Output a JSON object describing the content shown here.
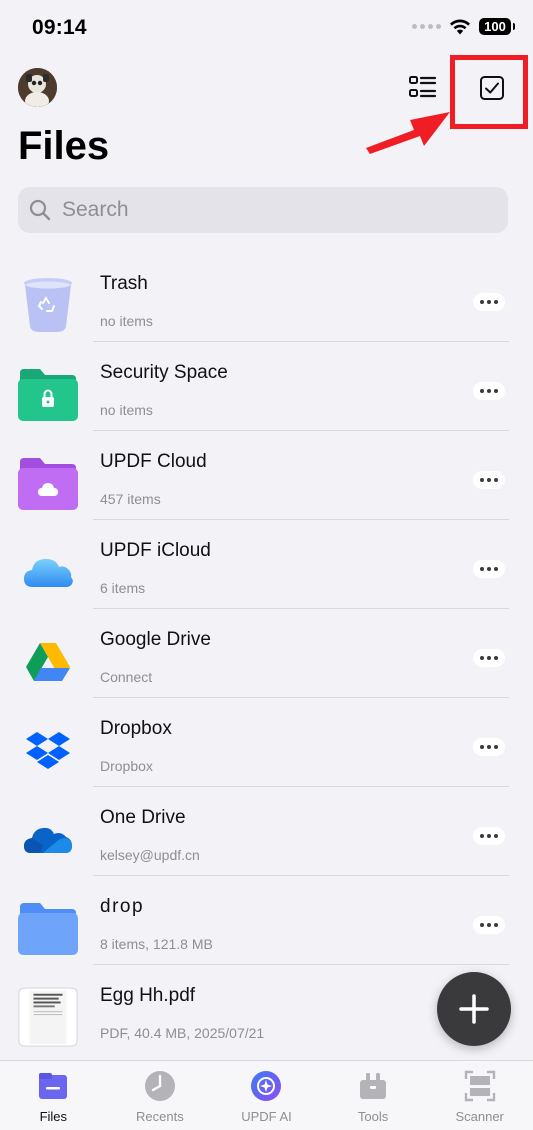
{
  "status_bar": {
    "time": "09:14",
    "battery": "100"
  },
  "header": {
    "title": "Files"
  },
  "search": {
    "placeholder": "Search"
  },
  "files": [
    {
      "name": "Trash",
      "subtitle": "no items",
      "icon": "trash-icon"
    },
    {
      "name": "Security Space",
      "subtitle": "no items",
      "icon": "lock-folder-icon"
    },
    {
      "name": "UPDF Cloud",
      "subtitle": "457 items",
      "icon": "cloud-folder-icon"
    },
    {
      "name": "UPDF iCloud",
      "subtitle": "6 items",
      "icon": "icloud-icon"
    },
    {
      "name": "Google Drive",
      "subtitle": "Connect",
      "icon": "google-drive-icon"
    },
    {
      "name": "Dropbox",
      "subtitle": "Dropbox",
      "icon": "dropbox-icon"
    },
    {
      "name": "One Drive",
      "subtitle": "kelsey@updf.cn",
      "icon": "onedrive-icon"
    },
    {
      "name": "drop",
      "subtitle": "8 items, 121.8 MB",
      "icon": "folder-icon"
    },
    {
      "name": "Egg Hh.pdf",
      "subtitle": "PDF, 40.4 MB, 2025/07/21",
      "icon": "pdf-thumbnail-icon"
    }
  ],
  "tabs": [
    {
      "label": "Files",
      "icon": "files-tab-icon",
      "active": true
    },
    {
      "label": "Recents",
      "icon": "clock-icon",
      "active": false
    },
    {
      "label": "UPDF AI",
      "icon": "updf-ai-icon",
      "active": false
    },
    {
      "label": "Tools",
      "icon": "toolbox-icon",
      "active": false
    },
    {
      "label": "Scanner",
      "icon": "scanner-icon",
      "active": false
    }
  ],
  "colors": {
    "highlight": "#f01e24",
    "background": "#f2f2f7",
    "accent": "#6a66ef"
  }
}
